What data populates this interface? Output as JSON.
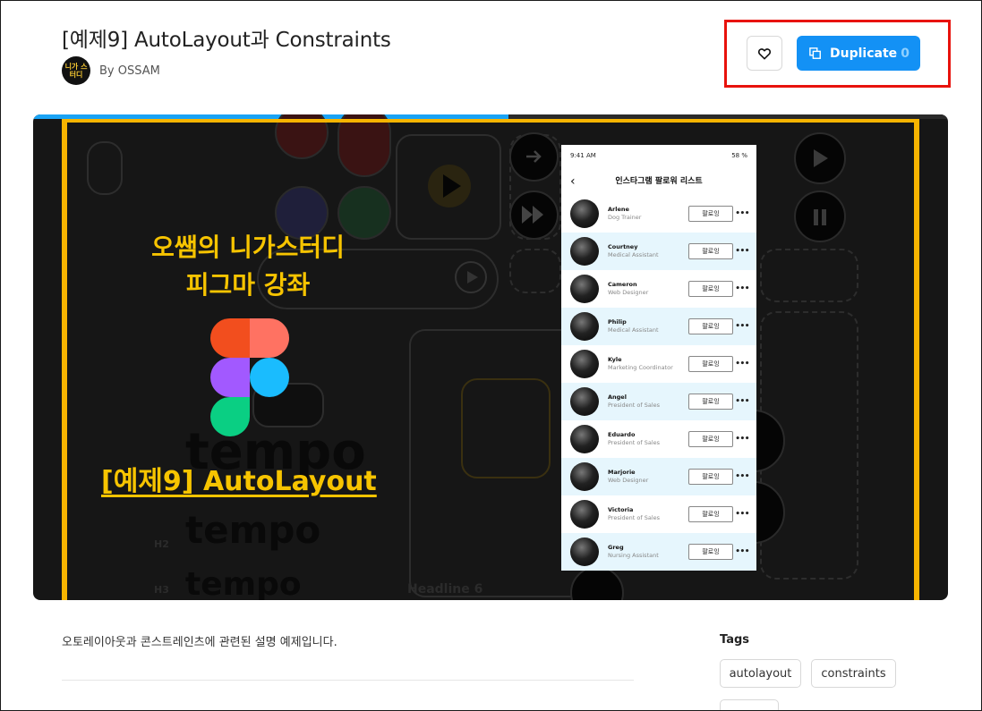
{
  "page": {
    "title": "[예제9] AutoLayout과 Constraints",
    "author_prefix": "By OSSAM",
    "avatar_text": "니가 스터디"
  },
  "actions": {
    "like_icon": "heart-icon",
    "duplicate_icon": "duplicate-icon",
    "duplicate_label": "Duplicate",
    "duplicate_count": "0",
    "highlight_color": "#e8120c",
    "accent_color": "#1391f5"
  },
  "hero": {
    "course_line1": "오쌤의 니가스터디",
    "course_line2": "피그마 강좌",
    "example_label": "[예제9] AutoLayout",
    "bg_words": [
      "tempo",
      "tempo",
      "tempo"
    ],
    "bg_headline": "Headline 6",
    "bg_tag": "H2",
    "bg_tag2": "H3",
    "progress": 0.52,
    "accent_yellow": "#f7b400"
  },
  "phone": {
    "time": "9:41 AM",
    "battery": "58 %",
    "back_icon": "chevron-left-icon",
    "header": "인스타그램 팔로워 리스트",
    "follow_label": "팔로잉",
    "more_icon": "more-icon",
    "users": [
      {
        "name": "Arlene",
        "role": "Dog Trainer"
      },
      {
        "name": "Courtney",
        "role": "Medical Assistant"
      },
      {
        "name": "Cameron",
        "role": "Web Designer"
      },
      {
        "name": "Philip",
        "role": "Medical Assistant"
      },
      {
        "name": "Kyle",
        "role": "Marketing Coordinator"
      },
      {
        "name": "Angel",
        "role": "President of Sales"
      },
      {
        "name": "Eduardo",
        "role": "President of Sales"
      },
      {
        "name": "Marjorie",
        "role": "Web Designer"
      },
      {
        "name": "Victoria",
        "role": "President of Sales"
      },
      {
        "name": "Greg",
        "role": "Nursing Assistant"
      }
    ]
  },
  "description": "오토레이아웃과 콘스트레인츠에 관련된 설명 예제입니다.",
  "tags": {
    "title": "Tags",
    "items": [
      "autolayout",
      "constraints"
    ]
  }
}
